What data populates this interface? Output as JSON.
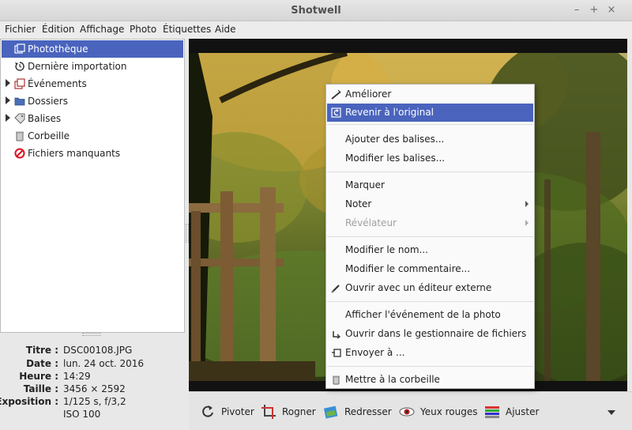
{
  "window": {
    "title": "Shotwell"
  },
  "menubar": [
    "Fichier",
    "Édition",
    "Affichage",
    "Photo",
    "Étiquettes",
    "Aide"
  ],
  "sidebar": {
    "items": [
      {
        "label": "Photothèque",
        "icon": "library-icon",
        "selected": true
      },
      {
        "label": "Dernière importation",
        "icon": "recent-import-icon"
      },
      {
        "label": "Événements",
        "icon": "events-icon",
        "expander": true
      },
      {
        "label": "Dossiers",
        "icon": "folder-icon",
        "expander": true
      },
      {
        "label": "Balises",
        "icon": "tag-icon",
        "expander": true
      },
      {
        "label": "Corbeille",
        "icon": "trash-icon"
      },
      {
        "label": "Fichiers manquants",
        "icon": "missing-files-icon"
      }
    ]
  },
  "metadata": [
    {
      "key": "Titre :",
      "value": "DSC00108.JPG"
    },
    {
      "key": "Date :",
      "value": "lun. 24 oct. 2016"
    },
    {
      "key": "Heure :",
      "value": "14:29"
    },
    {
      "key": "Taille :",
      "value": "3456 × 2592"
    },
    {
      "key": "Exposition :",
      "value": "1/125 s, f/3,2"
    },
    {
      "key": "",
      "value": "ISO 100"
    }
  ],
  "context_menu": {
    "items": [
      {
        "label": "Améliorer",
        "icon": "enhance-icon"
      },
      {
        "label": "Revenir à l'original",
        "icon": "revert-icon",
        "highlighted": true
      },
      {
        "separator": true
      },
      {
        "label": "Ajouter des balises..."
      },
      {
        "label": "Modifier les balises..."
      },
      {
        "separator": true
      },
      {
        "label": "Marquer"
      },
      {
        "label": "Noter",
        "submenu": true
      },
      {
        "label": "Révélateur",
        "submenu": true,
        "disabled": true
      },
      {
        "separator": true
      },
      {
        "label": "Modifier le nom..."
      },
      {
        "label": "Modifier le commentaire..."
      },
      {
        "label": "Ouvrir avec un éditeur externe",
        "icon": "external-editor-icon"
      },
      {
        "separator": true
      },
      {
        "label": "Afficher l'événement de la photo"
      },
      {
        "label": "Ouvrir dans le gestionnaire de fichiers",
        "icon": "file-manager-icon"
      },
      {
        "label": "Envoyer à ...",
        "icon": "send-to-icon"
      },
      {
        "separator": true
      },
      {
        "label": "Mettre à la corbeille",
        "icon": "trash-icon"
      }
    ]
  },
  "toolbar": {
    "buttons": [
      {
        "label": "Pivoter",
        "icon": "rotate-icon"
      },
      {
        "label": "Rogner",
        "icon": "crop-icon"
      },
      {
        "label": "Redresser",
        "icon": "straighten-icon"
      },
      {
        "label": "Yeux rouges",
        "icon": "red-eye-icon"
      },
      {
        "label": "Ajuster",
        "icon": "adjust-icon"
      }
    ],
    "more_icon": "chevron-down-icon"
  },
  "colors": {
    "selection": "#4a64bd",
    "window_bg": "#e8e8e8",
    "viewer_bg": "#111111"
  }
}
